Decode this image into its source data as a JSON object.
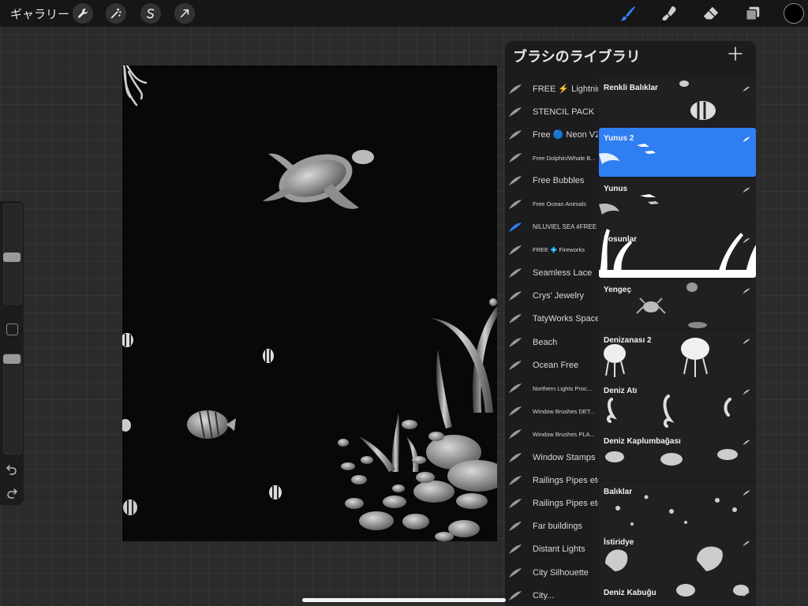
{
  "topbar": {
    "gallery_label": "ギャラリー",
    "left_tools": [
      "wrench-icon",
      "magic-wand-icon",
      "selection-icon",
      "transform-arrow-icon"
    ],
    "right_tools": [
      "brush-icon",
      "smudge-icon",
      "eraser-icon",
      "layers-icon"
    ],
    "accent_color": "#2f7ff3",
    "current_color": "#000000"
  },
  "library": {
    "title": "ブラシのライブラリ",
    "add_icon": "plus-icon",
    "sets": [
      {
        "label": "FREE ⚡ Lightning",
        "small": false
      },
      {
        "label": "STENCIL PACK",
        "small": false
      },
      {
        "label": "Free 🔵 Neon V2",
        "small": false
      },
      {
        "label": "Free Dolphin/Whale B...",
        "small": true
      },
      {
        "label": "Free Bubbles",
        "small": false
      },
      {
        "label": "Free Ocean Animals",
        "small": true
      },
      {
        "label": "NILUVIEL SEA #FREE",
        "small": true,
        "active": true
      },
      {
        "label": "FREE 💠 Fireworks",
        "small": true
      },
      {
        "label": "Seamless Lace",
        "small": false
      },
      {
        "label": "Crys' Jewelry",
        "small": false
      },
      {
        "label": "TatyWorks Space",
        "small": false
      },
      {
        "label": "Beach",
        "small": false
      },
      {
        "label": "Ocean Free",
        "small": false
      },
      {
        "label": "Northern Lights Proc...",
        "small": true
      },
      {
        "label": "Window Brushes DET...",
        "small": true
      },
      {
        "label": "Window Brushes PLA...",
        "small": true
      },
      {
        "label": "Window Stamps",
        "small": false
      },
      {
        "label": "Railings Pipes etc",
        "small": false
      },
      {
        "label": "Railings Pipes etc",
        "small": false
      },
      {
        "label": "Far buildings",
        "small": false
      },
      {
        "label": "Distant Lights",
        "small": false
      },
      {
        "label": "City Silhouette",
        "small": false
      },
      {
        "label": "City...",
        "small": false
      }
    ],
    "brushes": [
      {
        "name": "Renkli Balıklar",
        "art": "fish"
      },
      {
        "name": "Yunus 2",
        "art": "dolphin2",
        "active": true
      },
      {
        "name": "Yunus",
        "art": "dolphin"
      },
      {
        "name": "Yosunlar",
        "art": "seaweed"
      },
      {
        "name": "Yengeç",
        "art": "crab"
      },
      {
        "name": "Denizanası 2",
        "art": "jelly"
      },
      {
        "name": "Deniz Atı",
        "art": "seahorse"
      },
      {
        "name": "Deniz Kaplumbağası",
        "art": "turtle"
      },
      {
        "name": "Balıklar",
        "art": "smallfish"
      },
      {
        "name": "İstiridye",
        "art": "shell"
      },
      {
        "name": "Deniz Kabuğu",
        "art": "shells"
      }
    ]
  }
}
